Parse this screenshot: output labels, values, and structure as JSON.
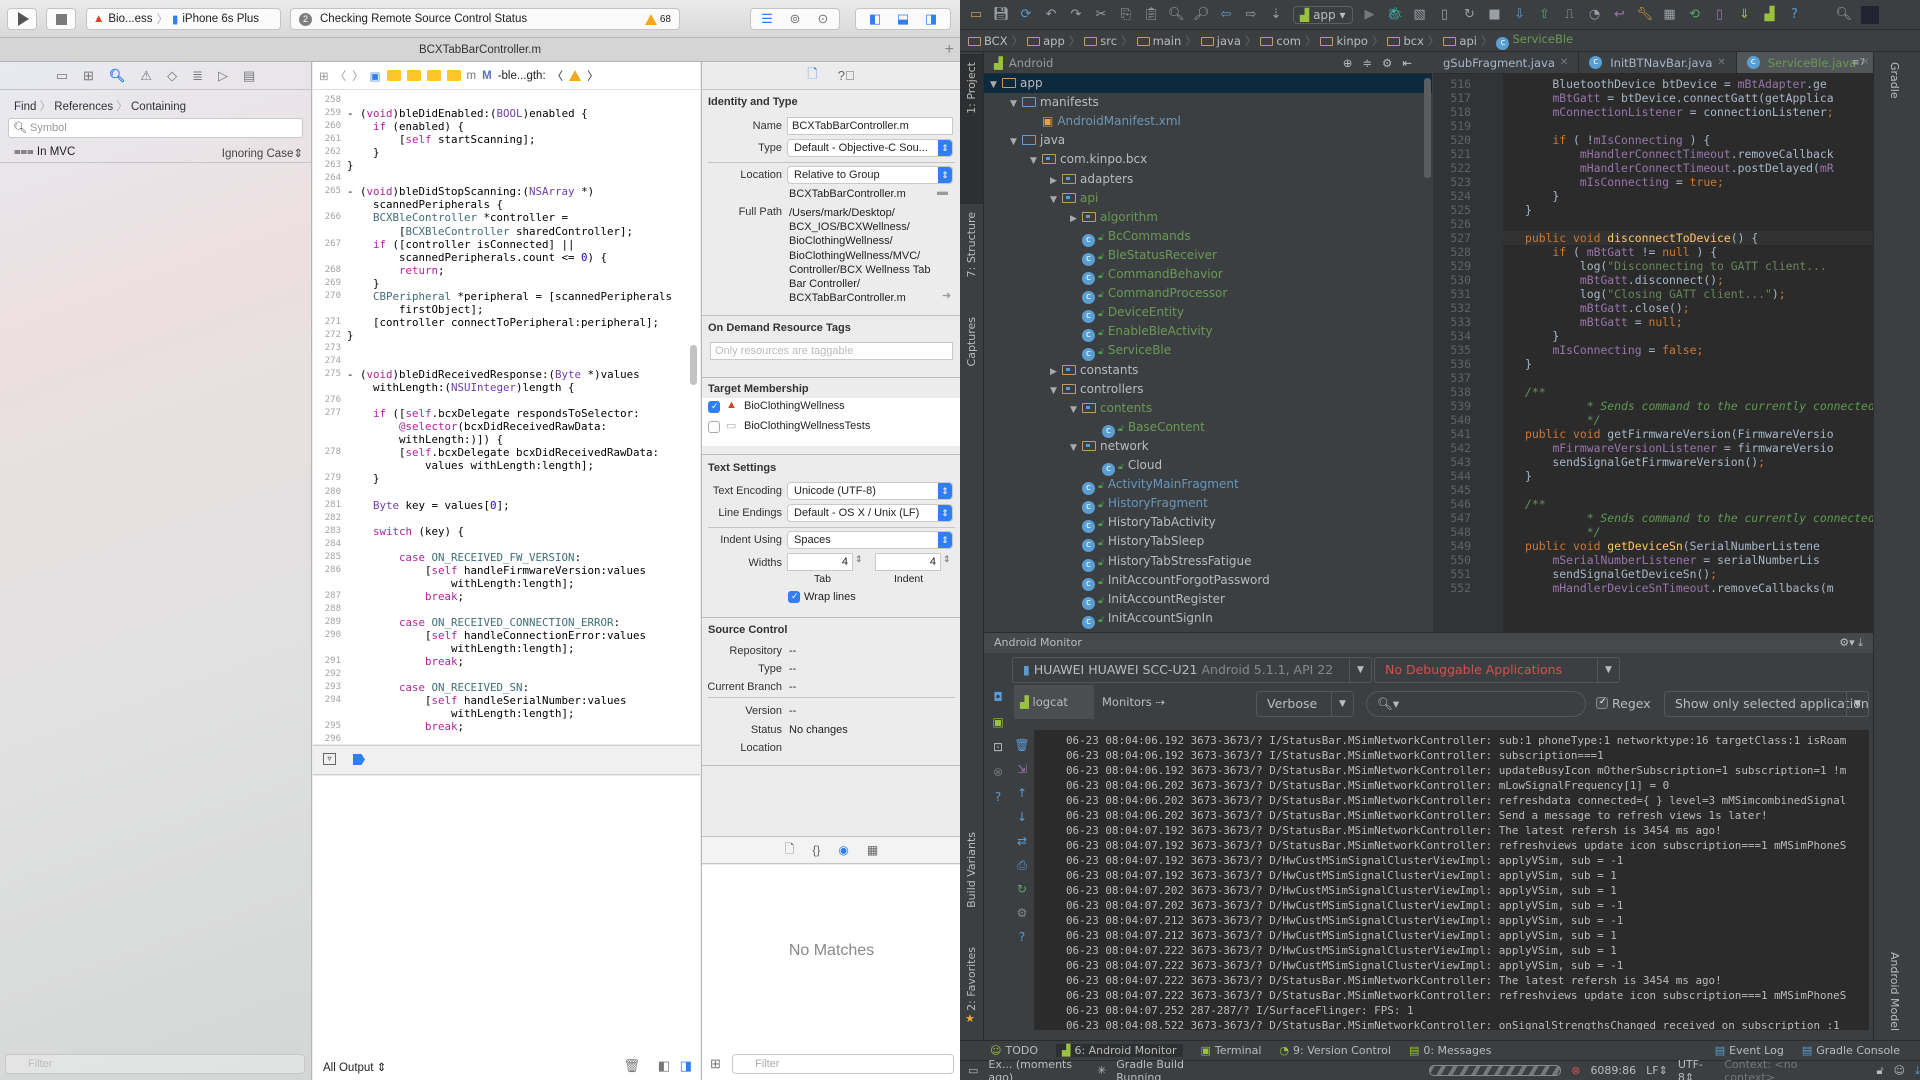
{
  "xcode": {
    "toolbar": {
      "scheme_target": "Bio...ess",
      "scheme_device": "iPhone 6s Plus",
      "activity_count": "2",
      "activity_text": "Checking Remote Source Control Status",
      "warning_count": "68"
    },
    "tab_title": "BCXTabBarController.m",
    "navigator": {
      "crumbs": [
        "Find",
        "References",
        "Containing"
      ],
      "search_placeholder": "Symbol",
      "scope": "In MVC",
      "match_mode": "Ignoring Case",
      "filter_placeholder": "Filter"
    },
    "jumpbar": {
      "method": "-ble...gth:"
    },
    "code": [
      {
        "n": "258",
        "t": ""
      },
      {
        "n": "259",
        "t": "- (void)bleDidEnabled:(BOOL)enabled {"
      },
      {
        "n": "260",
        "t": "    if (enabled) {"
      },
      {
        "n": "261",
        "t": "        [self startScanning];"
      },
      {
        "n": "262",
        "t": "    }"
      },
      {
        "n": "263",
        "t": "}"
      },
      {
        "n": "264",
        "t": ""
      },
      {
        "n": "265",
        "t": "- (void)bleDidStopScanning:(NSArray *)"
      },
      {
        "n": "",
        "t": "    scannedPeripherals {"
      },
      {
        "n": "266",
        "t": "    BCXBleController *controller ="
      },
      {
        "n": "",
        "t": "        [BCXBleController sharedController];"
      },
      {
        "n": "267",
        "t": "    if ([controller isConnected] ||"
      },
      {
        "n": "",
        "t": "        scannedPeripherals.count <= 0) {"
      },
      {
        "n": "268",
        "t": "        return;"
      },
      {
        "n": "269",
        "t": "    }"
      },
      {
        "n": "270",
        "t": "    CBPeripheral *peripheral = [scannedPeripherals"
      },
      {
        "n": "",
        "t": "        firstObject];"
      },
      {
        "n": "271",
        "t": "    [controller connectToPeripheral:peripheral];"
      },
      {
        "n": "272",
        "t": "}"
      },
      {
        "n": "273",
        "t": ""
      },
      {
        "n": "274",
        "t": ""
      },
      {
        "n": "275",
        "t": "- (void)bleDidReceivedResponse:(Byte *)values"
      },
      {
        "n": "",
        "t": "    withLength:(NSUInteger)length {"
      },
      {
        "n": "276",
        "t": ""
      },
      {
        "n": "277",
        "t": "    if ([self.bcxDelegate respondsToSelector:"
      },
      {
        "n": "",
        "t": "        @selector(bcxDidReceivedRawData:"
      },
      {
        "n": "",
        "t": "        withLength:)]) {"
      },
      {
        "n": "278",
        "t": "        [self.bcxDelegate bcxDidReceivedRawData:"
      },
      {
        "n": "",
        "t": "            values withLength:length];"
      },
      {
        "n": "279",
        "t": "    }"
      },
      {
        "n": "280",
        "t": ""
      },
      {
        "n": "281",
        "t": "    Byte key = values[0];"
      },
      {
        "n": "282",
        "t": ""
      },
      {
        "n": "283",
        "t": "    switch (key) {"
      },
      {
        "n": "284",
        "t": ""
      },
      {
        "n": "285",
        "t": "        case ON_RECEIVED_FW_VERSION:"
      },
      {
        "n": "286",
        "t": "            [self handleFirmwareVersion:values"
      },
      {
        "n": "",
        "t": "                withLength:length];"
      },
      {
        "n": "287",
        "t": "            break;"
      },
      {
        "n": "288",
        "t": ""
      },
      {
        "n": "289",
        "t": "        case ON_RECEIVED_CONNECTION_ERROR:"
      },
      {
        "n": "290",
        "t": "            [self handleConnectionError:values"
      },
      {
        "n": "",
        "t": "                withLength:length];"
      },
      {
        "n": "291",
        "t": "            break;"
      },
      {
        "n": "292",
        "t": ""
      },
      {
        "n": "293",
        "t": "        case ON_RECEIVED_SN:"
      },
      {
        "n": "294",
        "t": "            [self handleSerialNumber:values"
      },
      {
        "n": "",
        "t": "                withLength:length];"
      },
      {
        "n": "295",
        "t": "            break;"
      },
      {
        "n": "296",
        "t": ""
      }
    ],
    "console": {
      "output_selector": "All Output"
    },
    "inspector": {
      "identity_title": "Identity and Type",
      "name_label": "Name",
      "name_value": "BCXTabBarController.m",
      "type_label": "Type",
      "type_value": "Default - Objective-C Sou...",
      "location_label": "Location",
      "location_value": "Relative to Group",
      "file_name": "BCXTabBarController.m",
      "full_path_label": "Full Path",
      "full_path_lines": [
        "/Users/mark/Desktop/",
        "BCX_IOS/BCXWellness/",
        "BioClothingWellness/",
        "BioClothingWellness/MVC/",
        "Controller/BCX Wellness Tab",
        "Bar Controller/",
        "BCXTabBarController.m"
      ],
      "odr_title": "On Demand Resource Tags",
      "odr_placeholder": "Only resources are taggable",
      "target_title": "Target Membership",
      "targets": [
        {
          "name": "BioClothingWellness",
          "checked": true
        },
        {
          "name": "BioClothingWellnessTests",
          "checked": false
        }
      ],
      "text_settings_title": "Text Settings",
      "encoding_label": "Text Encoding",
      "encoding_value": "Unicode (UTF-8)",
      "line_endings_label": "Line Endings",
      "line_endings_value": "Default - OS X / Unix (LF)",
      "indent_using_label": "Indent Using",
      "indent_using_value": "Spaces",
      "widths_label": "Widths",
      "tab_width": "4",
      "indent_width": "4",
      "tab_caption": "Tab",
      "indent_caption": "Indent",
      "wrap_lines_label": "Wrap lines",
      "wrap_lines": true,
      "sc_title": "Source Control",
      "repository_label": "Repository",
      "repository_value": "--",
      "sc_type_label": "Type",
      "sc_type_value": "--",
      "branch_label": "Current Branch",
      "branch_value": "--",
      "version_label": "Version",
      "version_value": "--",
      "status_label": "Status",
      "status_value": "No changes",
      "sc_location_label": "Location",
      "no_matches": "No Matches",
      "filter_placeholder": "Filter"
    }
  },
  "android_studio": {
    "run_config": "app",
    "breadcrumb": [
      "BCX",
      "app",
      "src",
      "main",
      "java",
      "com",
      "kinpo",
      "bcx",
      "api",
      "ServiceBle"
    ],
    "left_tool_windows": [
      "1: Project",
      "7: Structure",
      "Captures",
      "Build Variants",
      "2: Favorites"
    ],
    "right_tool_windows": [
      "Gradle",
      "Android Model"
    ],
    "project_view": "Android",
    "tree": [
      {
        "label": "app",
        "depth": 0,
        "kind": "module",
        "expanded": true,
        "color": "wht",
        "selected": true
      },
      {
        "label": "manifests",
        "depth": 1,
        "kind": "folder",
        "expanded": true,
        "color": "wht"
      },
      {
        "label": "AndroidManifest.xml",
        "depth": 2,
        "kind": "xml",
        "color": "blu"
      },
      {
        "label": "java",
        "depth": 1,
        "kind": "folder",
        "expanded": true,
        "color": "wht"
      },
      {
        "label": "com.kinpo.bcx",
        "depth": 2,
        "kind": "pkg",
        "expanded": true,
        "color": "wht"
      },
      {
        "label": "adapters",
        "depth": 3,
        "kind": "pkg",
        "expanded": false,
        "color": "wht"
      },
      {
        "label": "api",
        "depth": 3,
        "kind": "pkg",
        "expanded": true,
        "color": "green"
      },
      {
        "label": "algorithm",
        "depth": 4,
        "kind": "pkg",
        "expanded": false,
        "color": "green"
      },
      {
        "label": "BcCommands",
        "depth": 4,
        "kind": "class",
        "color": "green"
      },
      {
        "label": "BleStatusReceiver",
        "depth": 4,
        "kind": "class",
        "color": "green"
      },
      {
        "label": "CommandBehavior",
        "depth": 4,
        "kind": "class",
        "color": "green"
      },
      {
        "label": "CommandProcessor",
        "depth": 4,
        "kind": "class",
        "color": "green"
      },
      {
        "label": "DeviceEntity",
        "depth": 4,
        "kind": "class",
        "color": "green"
      },
      {
        "label": "EnableBleActivity",
        "depth": 4,
        "kind": "class",
        "color": "green"
      },
      {
        "label": "ServiceBle",
        "depth": 4,
        "kind": "class",
        "color": "green"
      },
      {
        "label": "constants",
        "depth": 3,
        "kind": "pkg",
        "expanded": false,
        "color": "wht"
      },
      {
        "label": "controllers",
        "depth": 3,
        "kind": "pkg",
        "expanded": true,
        "color": "wht"
      },
      {
        "label": "contents",
        "depth": 4,
        "kind": "pkg",
        "expanded": true,
        "color": "green"
      },
      {
        "label": "BaseContent",
        "depth": 5,
        "kind": "class",
        "color": "green"
      },
      {
        "label": "network",
        "depth": 4,
        "kind": "pkg",
        "expanded": true,
        "color": "wht"
      },
      {
        "label": "Cloud",
        "depth": 5,
        "kind": "class",
        "color": "wht"
      },
      {
        "label": "ActivityMainFragment",
        "depth": 4,
        "kind": "class",
        "color": "blu"
      },
      {
        "label": "HistoryFragment",
        "depth": 4,
        "kind": "class",
        "color": "blu"
      },
      {
        "label": "HistoryTabActivity",
        "depth": 4,
        "kind": "class",
        "color": "wht"
      },
      {
        "label": "HistoryTabSleep",
        "depth": 4,
        "kind": "class",
        "color": "wht"
      },
      {
        "label": "HistoryTabStressFatigue",
        "depth": 4,
        "kind": "class",
        "color": "wht"
      },
      {
        "label": "InitAccountForgotPassword",
        "depth": 4,
        "kind": "class",
        "color": "wht"
      },
      {
        "label": "InitAccountRegister",
        "depth": 4,
        "kind": "class",
        "color": "wht"
      },
      {
        "label": "InitAccountSignIn",
        "depth": 4,
        "kind": "class",
        "color": "wht"
      }
    ],
    "editor_tabs": [
      {
        "label": "gSubFragment.java",
        "active": false,
        "icon": false
      },
      {
        "label": "InitBTNavBar.java",
        "active": false,
        "icon": true
      },
      {
        "label": "ServiceBle.java",
        "active": true,
        "icon": true
      }
    ],
    "hidden_tabs": "7",
    "code": [
      {
        "n": "516",
        "h": "            BluetoothDevice btDevice = <span class=f>mBtAdapter</span>.ge"
      },
      {
        "n": "517",
        "h": "            <span class=f>mBtGatt</span> = btDevice.connectGatt(getApplica"
      },
      {
        "n": "518",
        "h": "            <span class=f>mConnectionListener</span> = connectionListener<span class=k>;</span>"
      },
      {
        "n": "519",
        "h": ""
      },
      {
        "n": "520",
        "h": "            <span class=k>if</span> ( !<span class=f>mIsConnecting</span> ) {"
      },
      {
        "n": "521",
        "h": "                <span class=f>mHandlerConnectTimeout</span>.removeCallback"
      },
      {
        "n": "522",
        "h": "                <span class=f>mHandlerConnectTimeout</span>.postDelayed(<span class=f>mR</span>"
      },
      {
        "n": "523",
        "h": "                <span class=f>mIsConnecting</span> = <span class=k>true;</span>"
      },
      {
        "n": "524",
        "h": "            }"
      },
      {
        "n": "525",
        "h": "        }"
      },
      {
        "n": "526",
        "h": ""
      },
      {
        "n": "527",
        "h": "        <span class=k>public void</span> <span class=m>disconnectToDevice</span>() {"
      },
      {
        "n": "528",
        "h": "            <span class=k>if</span> ( <span class=f>mBtGatt</span> != <span class=k>null</span> ) {"
      },
      {
        "n": "529",
        "h": "                log(<span class=s>\"Disconnecting to GATT client...</span>"
      },
      {
        "n": "530",
        "h": "                <span class=f>mBtGatt</span>.disconnect()<span class=k>;</span>"
      },
      {
        "n": "531",
        "h": "                log(<span class=s>\"Closing GATT client...\"</span>)<span class=k>;</span>"
      },
      {
        "n": "532",
        "h": "                <span class=f>mBtGatt</span>.close()<span class=k>;</span>"
      },
      {
        "n": "533",
        "h": "                <span class=f>mBtGatt</span> = <span class=k>null;</span>"
      },
      {
        "n": "534",
        "h": "            }"
      },
      {
        "n": "535",
        "h": "            <span class=f>mIsConnecting</span> = <span class=k>false;</span>"
      },
      {
        "n": "536",
        "h": "        }"
      },
      {
        "n": "537",
        "h": ""
      },
      {
        "n": "538",
        "h": "        <span class=c>/**</span>"
      },
      {
        "n": "539",
        "h": "<span class=c>         * Sends command to the currently connected B</span>"
      },
      {
        "n": "540",
        "h": "<span class=c>         */</span>"
      },
      {
        "n": "541",
        "h": "        <span class=k>public void</span> getFirmwareVersion(FirmwareVersio"
      },
      {
        "n": "542",
        "h": "            <span class=f>mFirmwareVersionListener</span> = firmwareVersio"
      },
      {
        "n": "543",
        "h": "            sendSignalGetFirmwareVersion()<span class=k>;</span>"
      },
      {
        "n": "544",
        "h": "        }"
      },
      {
        "n": "545",
        "h": ""
      },
      {
        "n": "546",
        "h": "        <span class=c>/**</span>"
      },
      {
        "n": "547",
        "h": "<span class=c>         * Sends command to the currently connected B</span>"
      },
      {
        "n": "548",
        "h": "<span class=c>         */</span>"
      },
      {
        "n": "549",
        "h": "        <span class=k>public void</span> <span class=m>getDeviceSn</span>(SerialNumberListene"
      },
      {
        "n": "550",
        "h": "            <span class=f>mSerialNumberListener</span> = serialNumberLis"
      },
      {
        "n": "551",
        "h": "            sendSignalGetDeviceSn()<span class=k>;</span>"
      },
      {
        "n": "552",
        "h": "            <span class=f>mHandlerDeviceSnTimeout</span>.removeCallbacks(m"
      }
    ],
    "monitor": {
      "title": "Android Monitor",
      "device_name": "HUAWEI HUAWEI SCC-U21",
      "device_os": "Android 5.1.1, API 22",
      "process": "No Debuggable Applications",
      "tab_logcat": "logcat",
      "tab_monitors": "Monitors",
      "log_level": "Verbose",
      "search_value": "",
      "regex_label": "Regex",
      "regex_checked": true,
      "filter": "Show only selected application",
      "log": [
        "06-23 08:04:06.192 3673-3673/? I/StatusBar.MSimNetworkController: sub:1 phoneType:1 networktype:16 targetClass:1 isRoam",
        "06-23 08:04:06.192 3673-3673/? I/StatusBar.MSimNetworkController: subscription===1",
        "06-23 08:04:06.192 3673-3673/? D/StatusBar.MSimNetworkController: updateBusyIcon mOtherSubscription=1 subscription=1 !m",
        "06-23 08:04:06.202 3673-3673/? D/StatusBar.MSimNetworkController: mLowSignalFrequency[1] = 0",
        "06-23 08:04:06.202 3673-3673/? D/StatusBar.MSimNetworkController: refreshdata connected={ } level=3 mMSimcombinedSignal",
        "06-23 08:04:06.202 3673-3673/? D/StatusBar.MSimNetworkController: Send a message to refresh views 1s later!",
        "06-23 08:04:07.192 3673-3673/? D/StatusBar.MSimNetworkController: The latest refersh is 3454 ms ago!",
        "06-23 08:04:07.192 3673-3673/? D/StatusBar.MSimNetworkController: refreshviews update icon subscription===1 mMSimPhoneS",
        "06-23 08:04:07.192 3673-3673/? D/HwCustMSimSignalClusterViewImpl: applyVSim, sub = -1",
        "06-23 08:04:07.192 3673-3673/? D/HwCustMSimSignalClusterViewImpl: applyVSim, sub = 1",
        "06-23 08:04:07.202 3673-3673/? D/HwCustMSimSignalClusterViewImpl: applyVSim, sub = 1",
        "06-23 08:04:07.202 3673-3673/? D/HwCustMSimSignalClusterViewImpl: applyVSim, sub = -1",
        "06-23 08:04:07.212 3673-3673/? D/HwCustMSimSignalClusterViewImpl: applyVSim, sub = -1",
        "06-23 08:04:07.212 3673-3673/? D/HwCustMSimSignalClusterViewImpl: applyVSim, sub = 1",
        "06-23 08:04:07.222 3673-3673/? D/HwCustMSimSignalClusterViewImpl: applyVSim, sub = 1",
        "06-23 08:04:07.222 3673-3673/? D/HwCustMSimSignalClusterViewImpl: applyVSim, sub = -1",
        "06-23 08:04:07.222 3673-3673/? D/StatusBar.MSimNetworkController: The latest refersh is 3454 ms ago!",
        "06-23 08:04:07.222 3673-3673/? D/StatusBar.MSimNetworkController: refreshviews update icon subscription===1 mMSimPhoneS",
        "06-23 08:04:07.252 287-287/? I/SurfaceFlinger: FPS: 1",
        "06-23 08:04:08.522 3673-3673/? D/StatusBar.MSimNetworkController: onSignalStrengthsChanged received on subscription :1"
      ]
    },
    "bottom_tabs": [
      "TODO",
      "6: Android Monitor",
      "Terminal",
      "9: Version Control",
      "0: Messages"
    ],
    "bottom_right_tabs": [
      "Event Log",
      "Gradle Console"
    ],
    "status": {
      "message": "Ex... (moments ago)",
      "task": "Gradle Build Running",
      "position": "6089:86",
      "line_sep": "LF",
      "encoding": "UTF-8",
      "context": "Context: <no context>"
    },
    "colors": {
      "accent_red": "#d25252",
      "keyword": "#cc7832",
      "field": "#9876aa",
      "string": "#6a8759"
    }
  }
}
